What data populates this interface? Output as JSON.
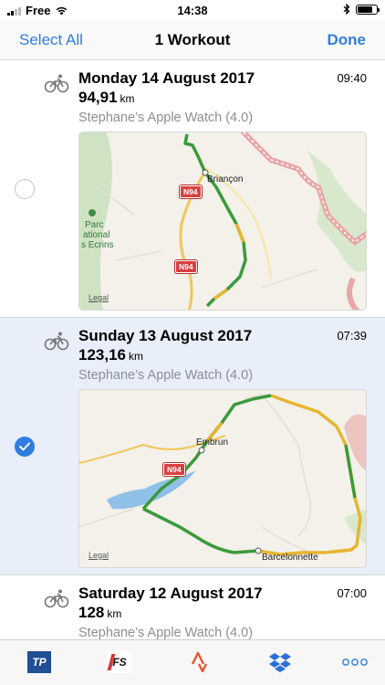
{
  "status_bar": {
    "carrier": "Free",
    "time": "14:38"
  },
  "nav": {
    "left": "Select All",
    "title": "1 Workout",
    "right": "Done"
  },
  "workouts": [
    {
      "date": "Monday 14 August 2017",
      "time": "09:40",
      "distance": "94,91",
      "unit": "km",
      "device": "Stephane’s Apple Watch (4.0)",
      "selected": false,
      "map": {
        "labels": [
          "Briançon",
          "Parc",
          "ational",
          "s Ecrins"
        ],
        "roads": [
          "N94",
          "N94"
        ],
        "legal": "Legal"
      }
    },
    {
      "date": "Sunday 13 August 2017",
      "time": "07:39",
      "distance": "123,16",
      "unit": "km",
      "device": "Stephane’s Apple Watch (4.0)",
      "selected": true,
      "map": {
        "labels": [
          "Embrun",
          "Barcelonnette"
        ],
        "roads": [
          "N94"
        ],
        "legal": "Legal"
      }
    },
    {
      "date": "Saturday 12 August 2017",
      "time": "07:00",
      "distance": "128",
      "unit": "km",
      "device": "Stephane’s Apple Watch (4.0)",
      "selected": false
    }
  ],
  "tab_bar": {
    "items": [
      {
        "icon": "trainingpeaks-icon",
        "text": "TP"
      },
      {
        "icon": "finalsurge-icon",
        "text": "FS"
      },
      {
        "icon": "strava-icon"
      },
      {
        "icon": "dropbox-icon"
      },
      {
        "icon": "more-icon"
      }
    ]
  },
  "colors": {
    "accent": "#2f7de1",
    "selected_row": "#e8eefa",
    "route_green": "#3a9a3a",
    "route_yellow": "#e6b530"
  }
}
